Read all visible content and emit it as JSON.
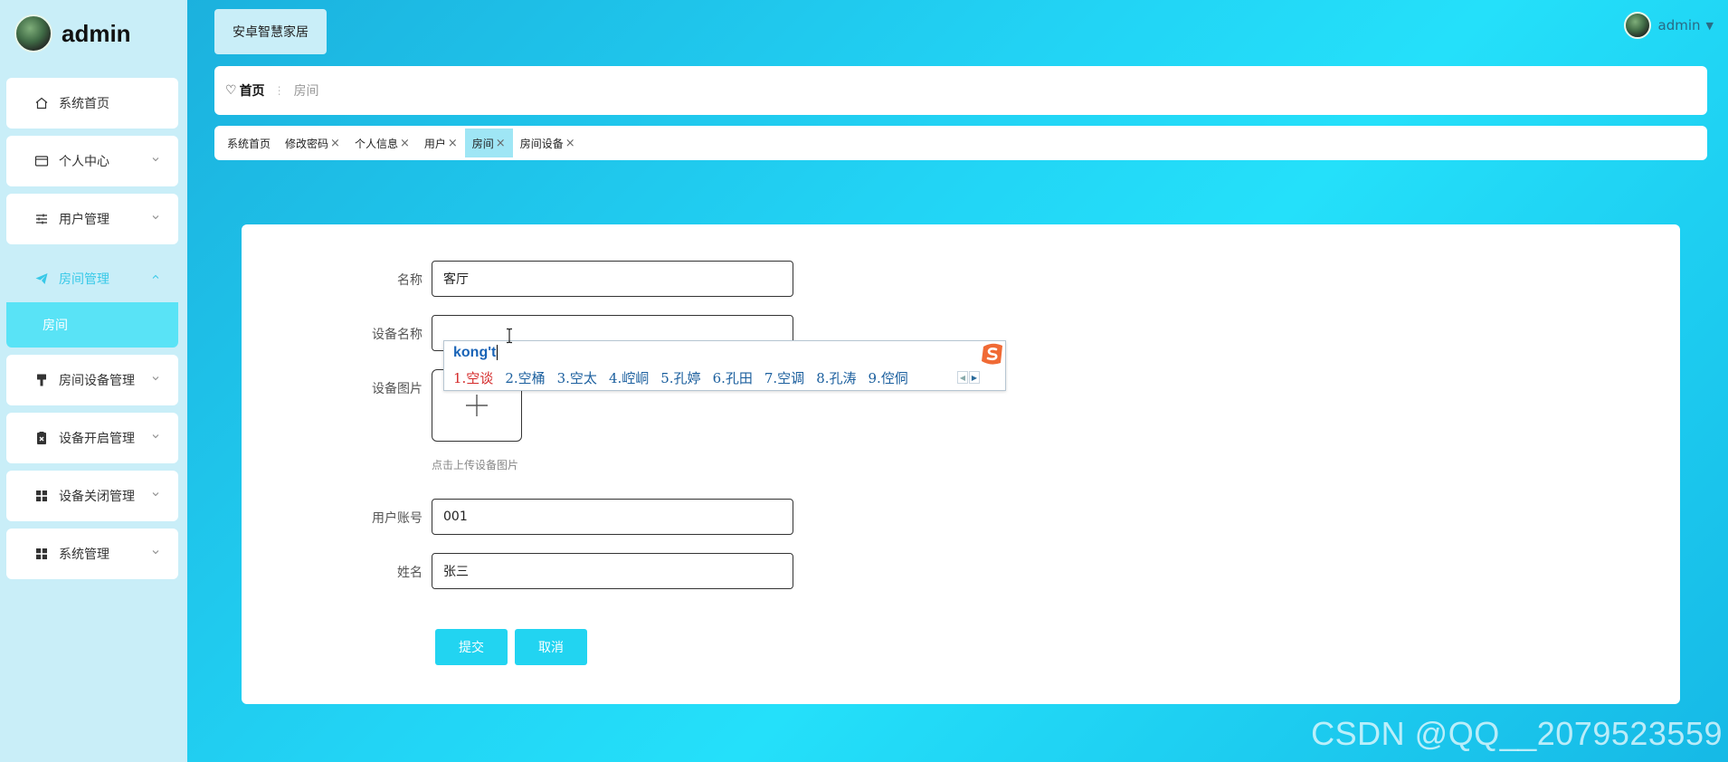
{
  "brand": {
    "name": "admin"
  },
  "sidebar": {
    "items": [
      {
        "label": "系统首页",
        "icon": "home-icon"
      },
      {
        "label": "个人中心",
        "icon": "card-icon"
      },
      {
        "label": "用户管理",
        "icon": "sliders-icon"
      },
      {
        "label": "房间管理",
        "icon": "send-icon",
        "active": true,
        "expanded": true
      },
      {
        "label": "房间设备管理",
        "icon": "brush-icon"
      },
      {
        "label": "设备开启管理",
        "icon": "clipboard-x-icon"
      },
      {
        "label": "设备关闭管理",
        "icon": "grid-icon"
      },
      {
        "label": "系统管理",
        "icon": "grid-icon"
      }
    ],
    "submenu": {
      "label": "房间"
    }
  },
  "header": {
    "app_title": "安卓智慧家居",
    "user": "admin"
  },
  "breadcrumb": {
    "home": "首页",
    "current": "房间"
  },
  "tabs": [
    {
      "label": "系统首页",
      "closable": false
    },
    {
      "label": "修改密码",
      "closable": true
    },
    {
      "label": "个人信息",
      "closable": true
    },
    {
      "label": "用户",
      "closable": true
    },
    {
      "label": "房间",
      "closable": true,
      "active": true
    },
    {
      "label": "房间设备",
      "closable": true
    }
  ],
  "tab_close_glyph": "×",
  "form": {
    "name_label": "名称",
    "name_value": "客厅",
    "device_name_label": "设备名称",
    "device_name_value": "",
    "device_image_label": "设备图片",
    "upload_hint": "点击上传设备图片",
    "account_label": "用户账号",
    "account_value": "001",
    "fullname_label": "姓名",
    "fullname_value": "张三",
    "submit_label": "提交",
    "cancel_label": "取消"
  },
  "ime": {
    "composition": "kong't",
    "candidates": [
      "1.空谈",
      "2.空桶",
      "3.空太",
      "4.崆峒",
      "5.孔婷",
      "6.孔田",
      "7.空调",
      "8.孔涛",
      "9.倥侗"
    ]
  },
  "colors": {
    "accent": "#22d4f1",
    "sidebar_bg": "#c9eef8",
    "active_text": "#38c9e8",
    "submenu_bg": "#59e3f6"
  },
  "watermark": "CSDN @QQ__2079523559"
}
